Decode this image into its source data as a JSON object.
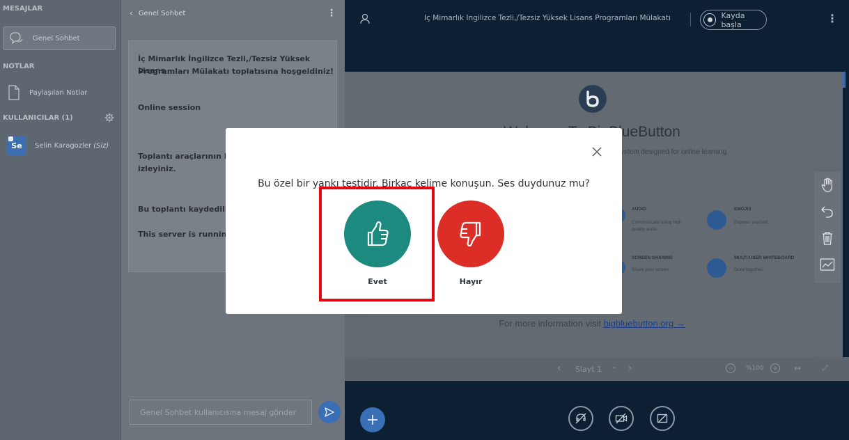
{
  "userlist": {
    "messages_header": "MESAJLAR",
    "public_chat": "Genel Sohbet",
    "notes_header": "NOTLAR",
    "shared_notes": "Paylaşılan Notlar",
    "users_header": "KULLANICILAR (1)",
    "user_avatar": "Se",
    "user_name": "Selin Karagozler",
    "user_you": "(Siz)"
  },
  "chat": {
    "title": "Genel Sohbet",
    "messages": [
      "İç Mimarlık İngilizce Tezli,/Tezsiz Yüksek Lisans",
      "Programları Mülakatı toplatısına hoşgeldiniz!",
      "Online session",
      "Toplantı araçlarının ku",
      "izleyiniz.",
      "Bu toplantı kaydediliy",
      "This server is running"
    ],
    "input_placeholder": "Genel Sohbet kullanıcısına mesaj gönder"
  },
  "topbar": {
    "meeting_title": "İç Mimarlık İngilizce Tezli,/Tezsiz Yüksek Lisans Programları Mülakatı",
    "record_label": "Kayda başla"
  },
  "slide": {
    "heading": "Welcome To BigBlueButton",
    "subheading": "BigBlueButton is an open source web conferencing system designed for online learning",
    "features": [
      {
        "title": "AUDIO",
        "desc1": "Communicate using high",
        "desc2": "quality audio."
      },
      {
        "title": "EMOJIS",
        "desc1": "Express yourself.",
        "desc2": ""
      },
      {
        "title": "SCREEN SHARING",
        "desc1": "Share your screen.",
        "desc2": ""
      },
      {
        "title": "MULTI-USER WHITEBOARD",
        "desc1": "Draw together.",
        "desc2": ""
      }
    ],
    "more_info": "For more information visit",
    "link": "bigbluebutton.org →"
  },
  "slide_nav": {
    "slide_label": "Slayt 1",
    "zoom": "%100"
  },
  "modal": {
    "question": "Bu özel bir yankı testidir. Birkaç kelime konuşun. Ses duydunuz mu?",
    "yes_label": "Evet",
    "no_label": "Hayır"
  },
  "colors": {
    "yes": "#1c8a7f",
    "no": "#dc2d27",
    "highlight": "#e40613",
    "topbar": "#0c1f33"
  }
}
